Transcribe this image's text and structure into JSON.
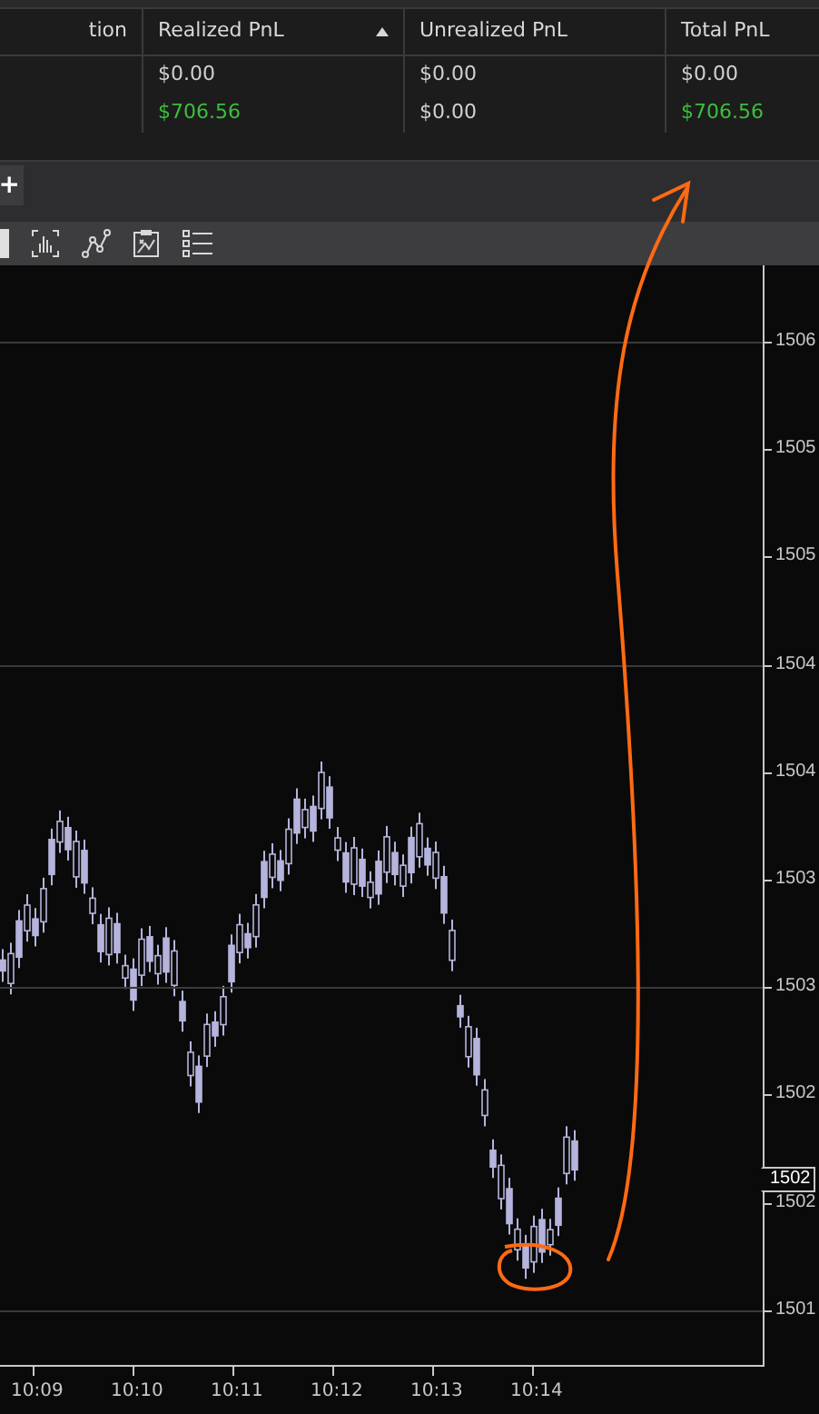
{
  "table": {
    "columns": [
      {
        "label": "tion",
        "sorted": false
      },
      {
        "label": "Realized PnL",
        "sorted": true
      },
      {
        "label": "Unrealized PnL",
        "sorted": false
      },
      {
        "label": "Total PnL",
        "sorted": false
      }
    ],
    "rows": [
      [
        "",
        {
          "text": "$0.00",
          "kind": "neutral"
        },
        {
          "text": "$0.00",
          "kind": "neutral"
        },
        {
          "text": "$0.00",
          "kind": "neutral"
        }
      ],
      [
        "",
        {
          "text": "$706.56",
          "kind": "gain"
        },
        {
          "text": "$0.00",
          "kind": "neutral"
        },
        {
          "text": "$706.56",
          "kind": "gain"
        }
      ]
    ]
  },
  "tab_bar": {
    "add_label": "+"
  },
  "chart": {
    "price_labels": [
      {
        "text": "1506",
        "grid": true
      },
      {
        "text": "1505",
        "grid": false
      },
      {
        "text": "1505",
        "grid": false
      },
      {
        "text": "1504",
        "grid": true
      },
      {
        "text": "1504",
        "grid": false
      },
      {
        "text": "1503",
        "grid": false
      },
      {
        "text": "1503",
        "grid": true
      },
      {
        "text": "1502",
        "grid": false
      },
      {
        "text": "1502",
        "grid": false
      },
      {
        "text": "1501",
        "grid": true
      }
    ],
    "current_price": "1502",
    "time_labels": [
      "10:09",
      "10:10",
      "10:11",
      "10:12",
      "10:13",
      "10:14"
    ]
  }
}
